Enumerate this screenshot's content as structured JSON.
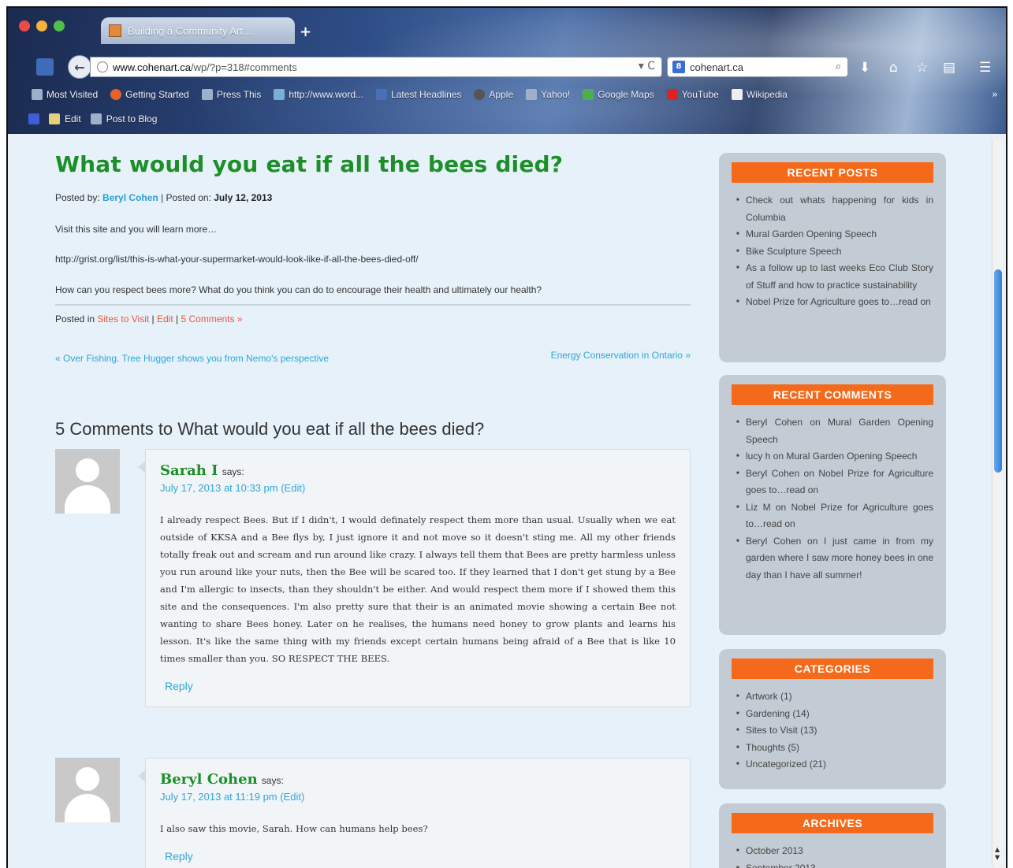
{
  "browser": {
    "tab_title": "Building a Community Art ...",
    "new_tab": "+",
    "url_host": "www.cohenart.ca",
    "url_path": "/wp/?p=318#comments",
    "search_text": "cohenart.ca",
    "bookmarks": [
      "Most Visited",
      "Getting Started",
      "Press This",
      "http://www.word...",
      "Latest Headlines",
      "Apple",
      "Yahoo!",
      "Google Maps",
      "YouTube",
      "Wikipedia"
    ],
    "tools": [
      "Edit",
      "Post to Blog"
    ]
  },
  "post": {
    "title": "What would you eat if all the bees died?",
    "posted_by_label": "Posted by:",
    "author": "Beryl Cohen",
    "posted_on_label": "| Posted on:",
    "date": "July 12, 2013",
    "p1": "Visit this site and you will learn more…",
    "p2": "http://grist.org/list/this-is-what-your-supermarket-would-look-like-if-all-the-bees-died-off/",
    "p3": "How can you respect bees more?  What do you think you can do to encourage their health and ultimately our health?",
    "posted_in_label": "Posted in",
    "category": "Sites to Visit",
    "edit": "Edit",
    "comments_link": "5 Comments »",
    "prev": "« Over Fishing. Tree Hugger shows you from Nemo's perspective",
    "next": "Energy Conservation in Ontario »"
  },
  "comments": {
    "title": "5 Comments to What would you eat if all the bees died?",
    "items": [
      {
        "author": "Sarah I",
        "says": "says:",
        "date": "July 17, 2013 at 10:33 pm  (Edit)",
        "body": "I already respect Bees. But if I didn't, I would definately respect them more than usual. Usually when we eat outside of KKSA and a Bee flys by, I just ignore it and not move so it doesn't sting me. All my other friends totally freak out and scream and run around like crazy. I always tell them that Bees are pretty harmless unless you run around like your nuts, then the Bee will be scared too. If they learned that I don't get stung by a Bee and I'm allergic to insects, than they shouldn't be either. And would respect them more if I showed them this site and the consequences. I'm also pretty sure that their is an animated movie showing a certain Bee not wanting to share Bees honey. Later on he realises, the humans need honey to grow plants and learns his lesson. It's like the same thing with my friends except certain humans being afraid of a Bee that is like 10 times smaller than you. SO RESPECT THE BEES.",
        "reply": "Reply"
      },
      {
        "author": "Beryl Cohen",
        "says": "says:",
        "date": "July 17, 2013 at 11:19 pm  (Edit)",
        "body": "I also saw this movie, Sarah. How can humans help bees?",
        "reply": "Reply"
      }
    ]
  },
  "sidebar": {
    "recent_posts": {
      "title": "RECENT POSTS",
      "items": [
        "Check out whats happening for kids in Columbia",
        "Mural Garden Opening Speech",
        "Bike Sculpture Speech",
        "As a follow up to last weeks Eco Club Story of Stuff and how to practice sustainability",
        "Nobel Prize for Agriculture goes to…read on"
      ]
    },
    "recent_comments": {
      "title": "RECENT COMMENTS",
      "items": [
        "Beryl Cohen on Mural Garden Opening Speech",
        "lucy h on Mural Garden Opening Speech",
        "Beryl Cohen on Nobel Prize for Agriculture goes to…read on",
        "Liz M on Nobel Prize for Agriculture goes to…read on",
        "Beryl Cohen on I just came in from my garden where I saw more honey bees in one day than I have all summer!"
      ]
    },
    "categories": {
      "title": "CATEGORIES",
      "items": [
        "Artwork (1)",
        "Gardening (14)",
        "Sites to Visit (13)",
        "Thoughts (5)",
        "Uncategorized (21)"
      ]
    },
    "archives": {
      "title": "ARCHIVES",
      "items": [
        "October 2013",
        "September 2013"
      ]
    }
  }
}
